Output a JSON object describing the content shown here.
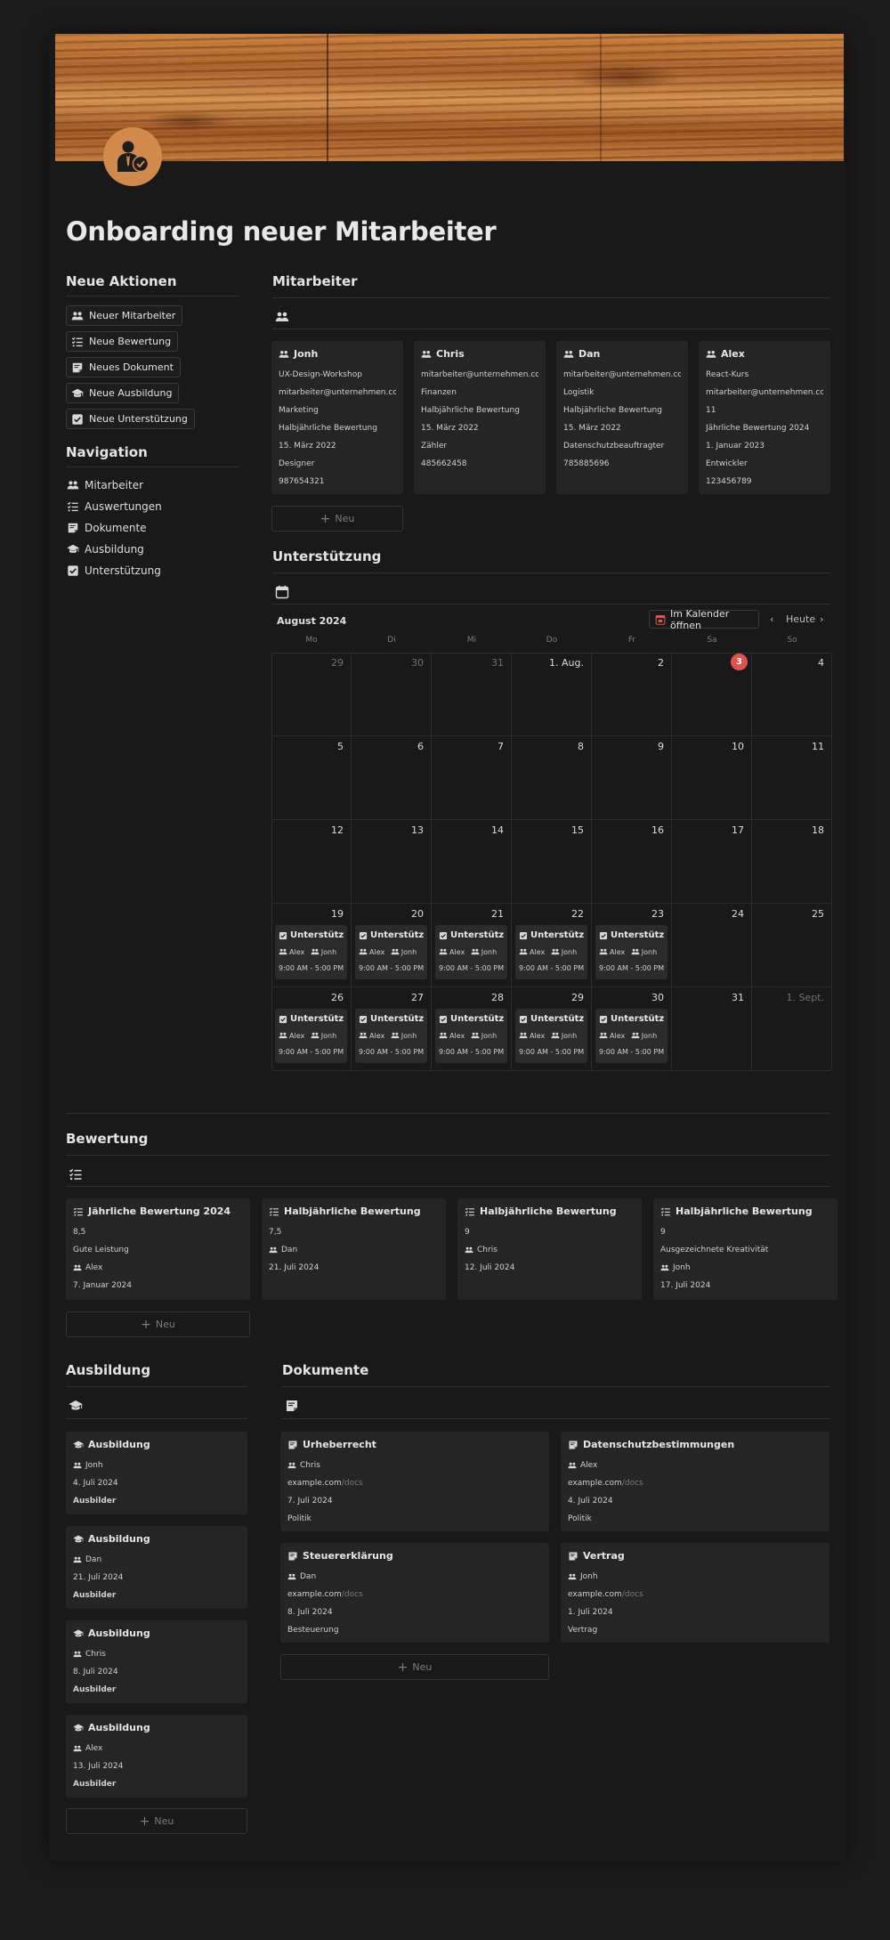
{
  "title": "Onboarding neuer Mitarbeiter",
  "sidebar": {
    "actions_heading": "Neue Aktionen",
    "actions": [
      {
        "label": "Neuer Mitarbeiter",
        "icon": "people-icon"
      },
      {
        "label": "Neue Bewertung",
        "icon": "checklist-icon"
      },
      {
        "label": "Neues Dokument",
        "icon": "document-icon"
      },
      {
        "label": "Neue Ausbildung",
        "icon": "graduation-cap-icon"
      },
      {
        "label": "Neue Unterstützung",
        "icon": "checkbox-icon"
      }
    ],
    "nav_heading": "Navigation",
    "nav": [
      {
        "label": "Mitarbeiter",
        "icon": "people-icon"
      },
      {
        "label": "Auswertungen",
        "icon": "checklist-icon"
      },
      {
        "label": "Dokumente",
        "icon": "document-icon"
      },
      {
        "label": "Ausbildung",
        "icon": "graduation-cap-icon"
      },
      {
        "label": "Unterstützung",
        "icon": "checkbox-icon"
      }
    ]
  },
  "employees": {
    "heading": "Mitarbeiter",
    "new_label": "Neu",
    "cards": [
      {
        "name": "Jonh",
        "props": [
          "UX-Design-Workshop",
          "mitarbeiter@unternehmen.com",
          "Marketing",
          "Halbjährliche Bewertung",
          "15. März 2022",
          "Designer",
          "987654321"
        ]
      },
      {
        "name": "Chris",
        "props": [
          "mitarbeiter@unternehmen.com",
          "Finanzen",
          "Halbjährliche Bewertung",
          "15. März 2022",
          "Zähler",
          "485662458"
        ]
      },
      {
        "name": "Dan",
        "props": [
          "mitarbeiter@unternehmen.com",
          "Logistik",
          "Halbjährliche Bewertung",
          "15. März 2022",
          "Datenschutzbeauftragter",
          "785885696"
        ]
      },
      {
        "name": "Alex",
        "props": [
          "React-Kurs",
          "mitarbeiter@unternehmen.com",
          "11",
          "Jährliche Bewertung 2024",
          "1. Januar 2023",
          "Entwickler",
          "123456789"
        ]
      }
    ]
  },
  "support": {
    "heading": "Unterstützung",
    "month": "August 2024",
    "open_calendar": "Im Kalender öffnen",
    "today_label": "Heute",
    "weekdays": [
      "Mo",
      "Di",
      "Mi",
      "Do",
      "Fr",
      "Sa",
      "So"
    ],
    "weeks": [
      [
        "29",
        "30",
        "31",
        "1. Aug.",
        "2",
        "3",
        "4"
      ],
      [
        "5",
        "6",
        "7",
        "8",
        "9",
        "10",
        "11"
      ],
      [
        "12",
        "13",
        "14",
        "15",
        "16",
        "17",
        "18"
      ],
      [
        "19",
        "20",
        "21",
        "22",
        "23",
        "24",
        "25"
      ],
      [
        "26",
        "27",
        "28",
        "29",
        "30",
        "31",
        "1. Sept."
      ]
    ],
    "today": "3",
    "event": {
      "title": "Unterstützung",
      "people": [
        "Alex",
        "Jonh"
      ],
      "time": "9:00 AM - 5:00 PM"
    }
  },
  "evaluation": {
    "heading": "Bewertung",
    "new_label": "Neu",
    "cards": [
      {
        "title": "Jährliche Bewertung 2024",
        "props": [
          "8,5",
          "Gute Leistung"
        ],
        "person": "Alex",
        "date": "7. Januar 2024"
      },
      {
        "title": "Halbjährliche Bewertung",
        "props": [
          "7,5"
        ],
        "person": "Dan",
        "date": "21. Juli 2024"
      },
      {
        "title": "Halbjährliche Bewertung",
        "props": [
          "9"
        ],
        "person": "Chris",
        "date": "12. Juli 2024"
      },
      {
        "title": "Halbjährliche Bewertung",
        "props": [
          "9",
          "Ausgezeichnete Kreativität"
        ],
        "person": "Jonh",
        "date": "17. Juli 2024"
      }
    ]
  },
  "training": {
    "heading": "Ausbildung",
    "new_label": "Neu",
    "cards": [
      {
        "title": "Ausbildung",
        "person": "Jonh",
        "date": "4. Juli 2024",
        "role": "Ausbilder"
      },
      {
        "title": "Ausbildung",
        "person": "Dan",
        "date": "21. Juli 2024",
        "role": "Ausbilder"
      },
      {
        "title": "Ausbildung",
        "person": "Chris",
        "date": "8. Juli 2024",
        "role": "Ausbilder"
      },
      {
        "title": "Ausbildung",
        "person": "Alex",
        "date": "13. Juli 2024",
        "role": "Ausbilder"
      }
    ]
  },
  "documents": {
    "heading": "Dokumente",
    "new_label": "Neu",
    "cards": [
      {
        "title": "Urheberrecht",
        "person": "Chris",
        "url_host": "example.com",
        "url_path": "/docs",
        "date": "7. Juli 2024",
        "category": "Politik"
      },
      {
        "title": "Datenschutzbestimmungen",
        "person": "Alex",
        "url_host": "example.com",
        "url_path": "/docs",
        "date": "4. Juli 2024",
        "category": "Politik"
      },
      {
        "title": "Steuererklärung",
        "person": "Dan",
        "url_host": "example.com",
        "url_path": "/docs",
        "date": "8. Juli 2024",
        "category": "Besteuerung"
      },
      {
        "title": "Vertrag",
        "person": "Jonh",
        "url_host": "example.com",
        "url_path": "/docs",
        "date": "1. Juli 2024",
        "category": "Vertrag"
      }
    ]
  },
  "colors": {
    "background": "#191919",
    "card": "#252525",
    "accent": "#d28a4c",
    "today": "#e0534d"
  }
}
